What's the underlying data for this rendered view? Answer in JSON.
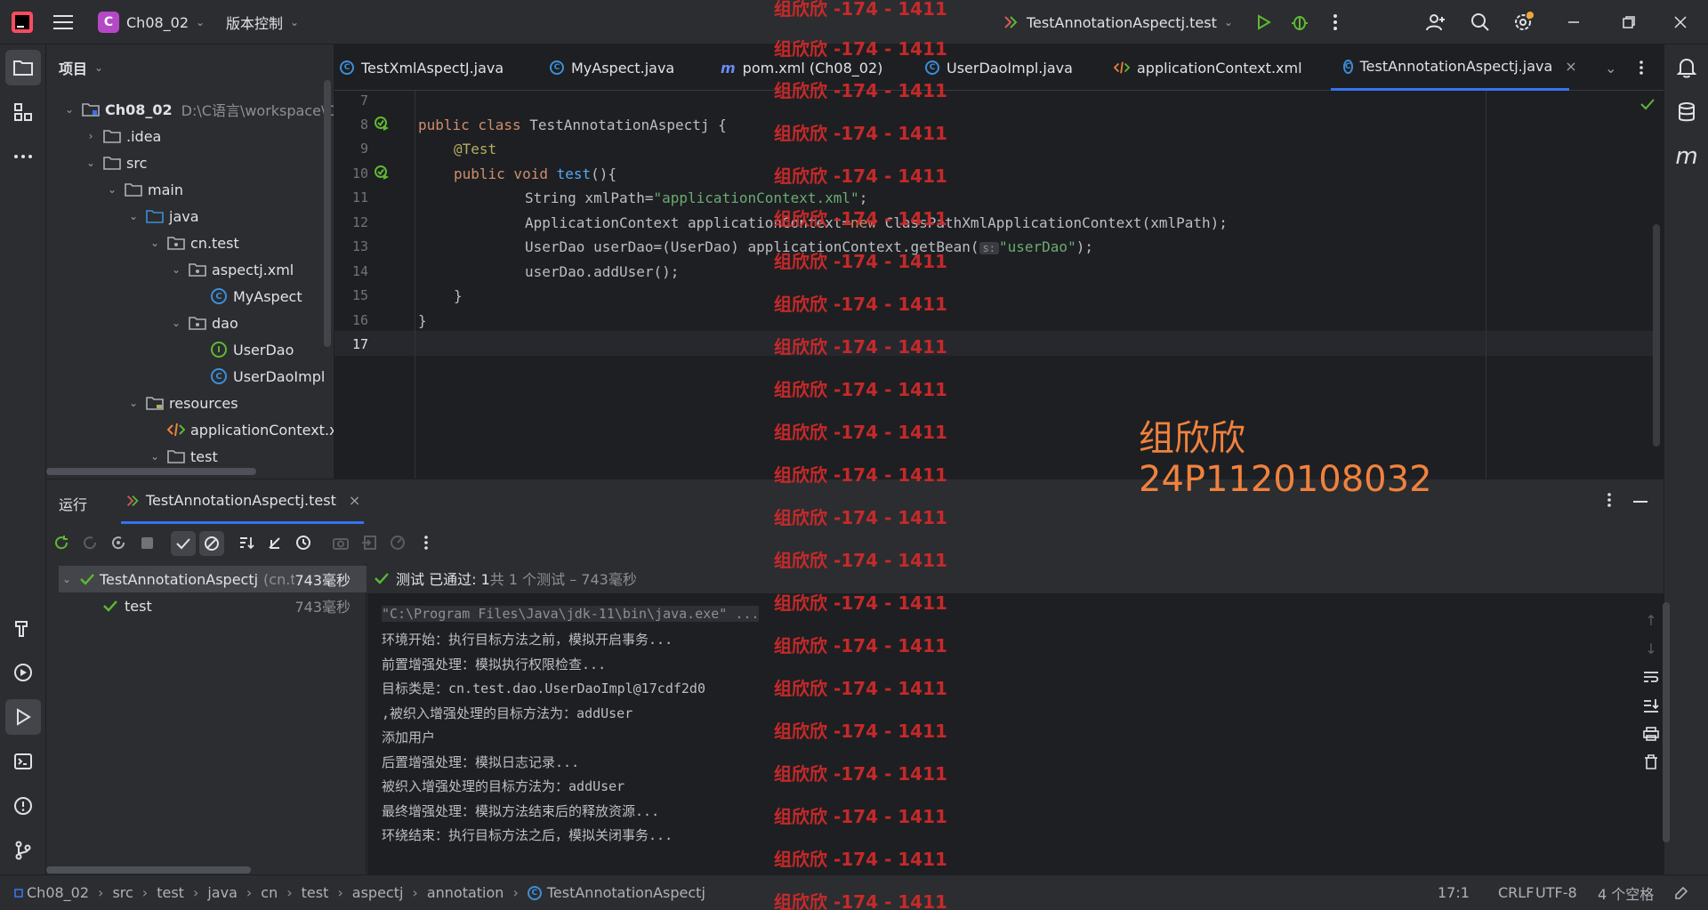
{
  "titlebar": {
    "project_initial": "C",
    "project_name": "Ch08_02",
    "vcs_label": "版本控制",
    "run_config": "TestAnnotationAspectj.test"
  },
  "project_pane": {
    "title": "项目",
    "tree": [
      {
        "label": "Ch08_02",
        "path": "D:\\C语言\\workspace\\C"
      },
      {
        "label": ".idea"
      },
      {
        "label": "src"
      },
      {
        "label": "main"
      },
      {
        "label": "java"
      },
      {
        "label": "cn.test"
      },
      {
        "label": "aspectj.xml"
      },
      {
        "label": "MyAspect"
      },
      {
        "label": "dao"
      },
      {
        "label": "UserDao"
      },
      {
        "label": "UserDaoImpl"
      },
      {
        "label": "resources"
      },
      {
        "label": "applicationContext.xml"
      },
      {
        "label": "test"
      }
    ]
  },
  "tabs": [
    {
      "label": "TestXmlAspectJ.java"
    },
    {
      "label": "MyAspect.java"
    },
    {
      "label": "pom.xml (Ch08_02)"
    },
    {
      "label": "UserDaoImpl.java"
    },
    {
      "label": "applicationContext.xml"
    },
    {
      "label": "TestAnnotationAspectj.java",
      "active": true
    }
  ],
  "editor": {
    "line_numbers": [
      "7",
      "8",
      "9",
      "10",
      "11",
      "12",
      "13",
      "14",
      "15",
      "16",
      "17"
    ],
    "code": {
      "l8_kw": "public class ",
      "l8_rest": "TestAnnotationAspectj {",
      "l9": "@Test",
      "l10_kw": "public void ",
      "l10_fn": "test",
      "l10_rest": "(){",
      "l11_a": "String xmlPath=",
      "l11_str": "\"applicationContext.xml\"",
      "l11_b": ";",
      "l12_a": "ApplicationContext applicationContext=",
      "l12_kw": "new ",
      "l12_b": "ClassPathXmlApplicationContext(xmlPath);",
      "l13_a": "UserDao userDao=(UserDao) applicationContext.getBean(",
      "l13_hint": "s:",
      "l13_str": "\"userDao\"",
      "l13_b": ");",
      "l14": "userDao.addUser();",
      "l15": "}",
      "l16": "}"
    }
  },
  "run_panel": {
    "title": "运行",
    "tab_label": "TestAnnotationAspectj.test",
    "tree_root": "TestAnnotationAspectj",
    "tree_root_pkg": "(cn.t",
    "tree_root_time": "743毫秒",
    "tree_child": "test",
    "tree_child_time": "743毫秒",
    "summary_pass": "测试 已通过: 1",
    "summary_rest": "共 1 个测试 – 743毫秒",
    "console_lines": [
      "\"C:\\Program Files\\Java\\jdk-11\\bin\\java.exe\" ...",
      "环境开始：执行目标方法之前，模拟开启事务...",
      "前置增强处理：模拟执行权限检查...",
      "目标类是：cn.test.dao.UserDaoImpl@17cdf2d0",
      ",被织入增强处理的目标方法为：addUser",
      "添加用户",
      "后置增强处理：模拟日志记录...",
      "被织入增强处理的目标方法为：addUser",
      "最终增强处理：模拟方法结束后的释放资源...",
      "环绕结束：执行目标方法之后，模拟关闭事务..."
    ]
  },
  "statusbar": {
    "breadcrumb": [
      "Ch08_02",
      "src",
      "test",
      "java",
      "cn",
      "test",
      "aspectj",
      "annotation",
      "TestAnnotationAspectj"
    ],
    "position": "17:1",
    "line_sep": "CRLF",
    "encoding": "UTF-8",
    "indent": "4 个空格"
  },
  "watermark": {
    "repeat_text": "组欣欣 -174 - 1411",
    "name": "组欣欣",
    "id": "24P1120108032"
  },
  "colors": {
    "accent": "#3574f0",
    "pass": "#5fb832",
    "watermark_red": "#d42a2a",
    "watermark_orange": "#f0823e"
  }
}
